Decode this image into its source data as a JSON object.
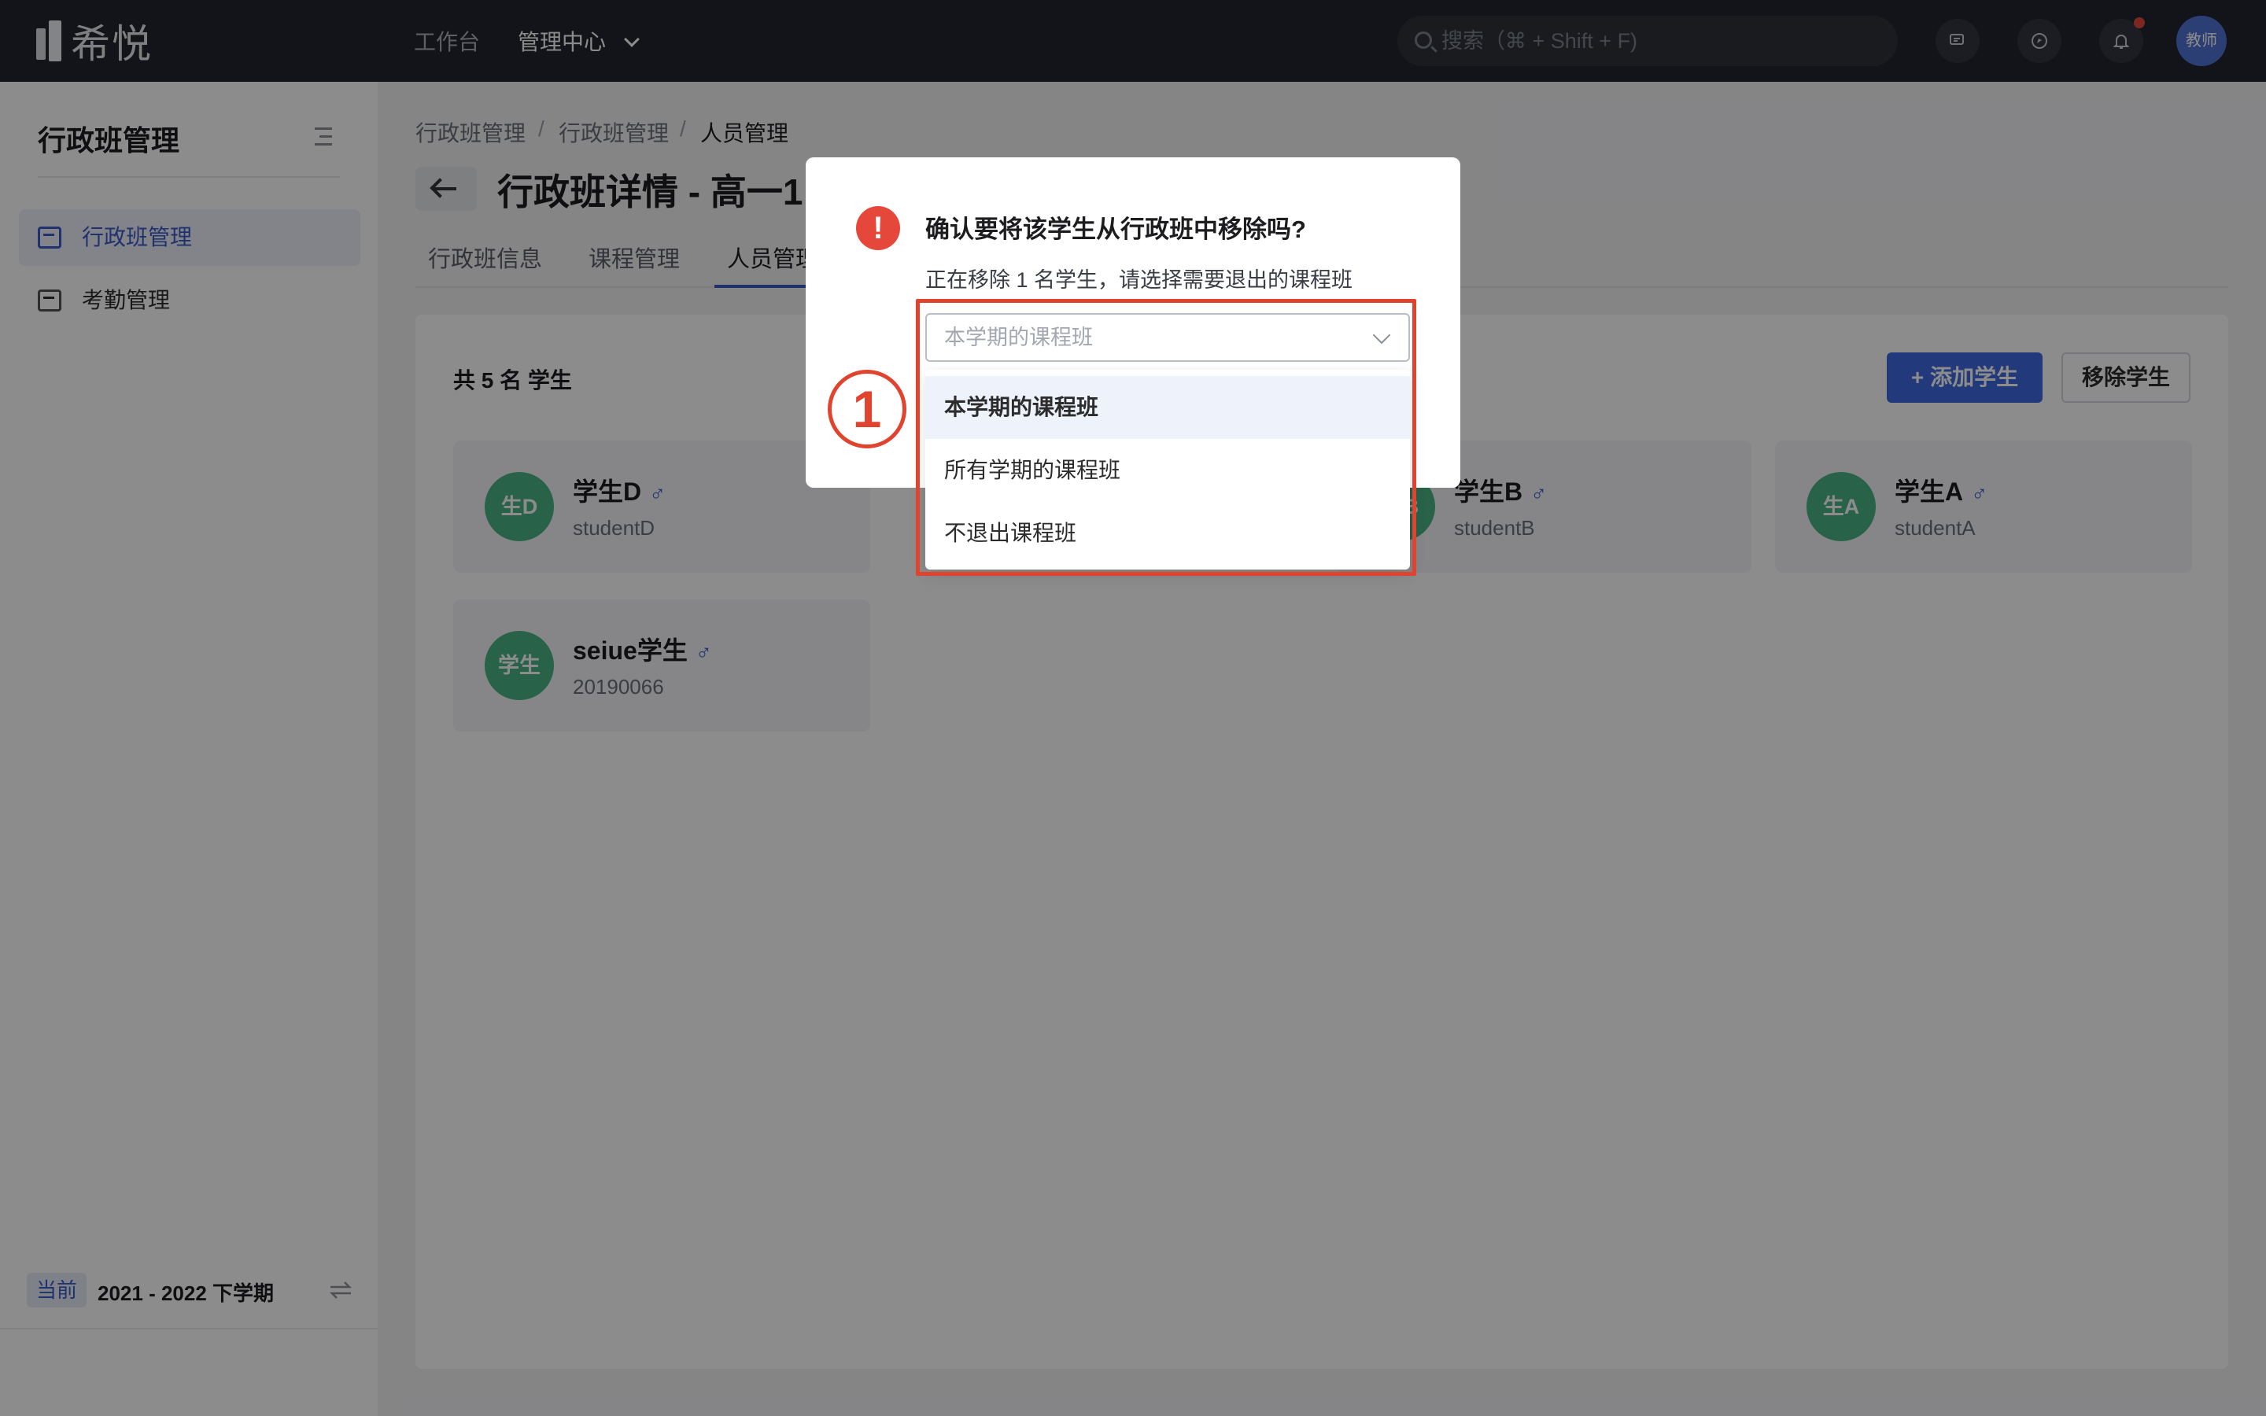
{
  "app": {
    "logo_text": "希悦"
  },
  "topnav": {
    "items": [
      {
        "label": "工作台"
      },
      {
        "label": "管理中心"
      }
    ],
    "search_placeholder": "搜索（⌘ + Shift + F)",
    "icons": [
      "chat-icon",
      "compass-icon",
      "bell-icon"
    ],
    "avatar_label": "教师"
  },
  "sidebar": {
    "title": "行政班管理",
    "items": [
      {
        "label": "行政班管理",
        "icon": "class-list-icon"
      },
      {
        "label": "考勤管理",
        "icon": "calendar-check-icon"
      }
    ],
    "term_badge": "当前",
    "term": "2021 - 2022 下学期"
  },
  "breadcrumb": [
    "行政班管理",
    "行政班管理",
    "人员管理"
  ],
  "page": {
    "title": "行政班详情 - 高一1",
    "tabs": [
      "行政班信息",
      "课程管理",
      "人员管理"
    ],
    "count_label": "共 5 名 学生",
    "add_button": "添加学生",
    "remove_button": "移除学生"
  },
  "students": [
    {
      "avatar": "生D",
      "name": "学生D",
      "id": "studentD",
      "gender": "♂"
    },
    {
      "avatar": "生B",
      "name": "学生B",
      "id": "studentB",
      "gender": "♂"
    },
    {
      "avatar": "生A",
      "name": "学生A",
      "id": "studentA",
      "gender": "♂"
    },
    {
      "avatar": "学生",
      "name": "seiue学生",
      "id": "20190066",
      "gender": "♂"
    }
  ],
  "modal": {
    "icon": "!",
    "title": "确认要将该学生从行政班中移除吗?",
    "description": "正在移除 1 名学生，请选择需要退出的课程班",
    "select_placeholder": "本学期的课程班",
    "options": [
      "本学期的课程班",
      "所有学期的课程班",
      "不退出课程班"
    ],
    "selected_option_index": 0
  },
  "annotation": {
    "marker": "1"
  },
  "colors": {
    "accent": "#3e6ae1",
    "highlight": "#e0442e",
    "avatar_green": "#48b285",
    "topbar": "#23262e"
  }
}
